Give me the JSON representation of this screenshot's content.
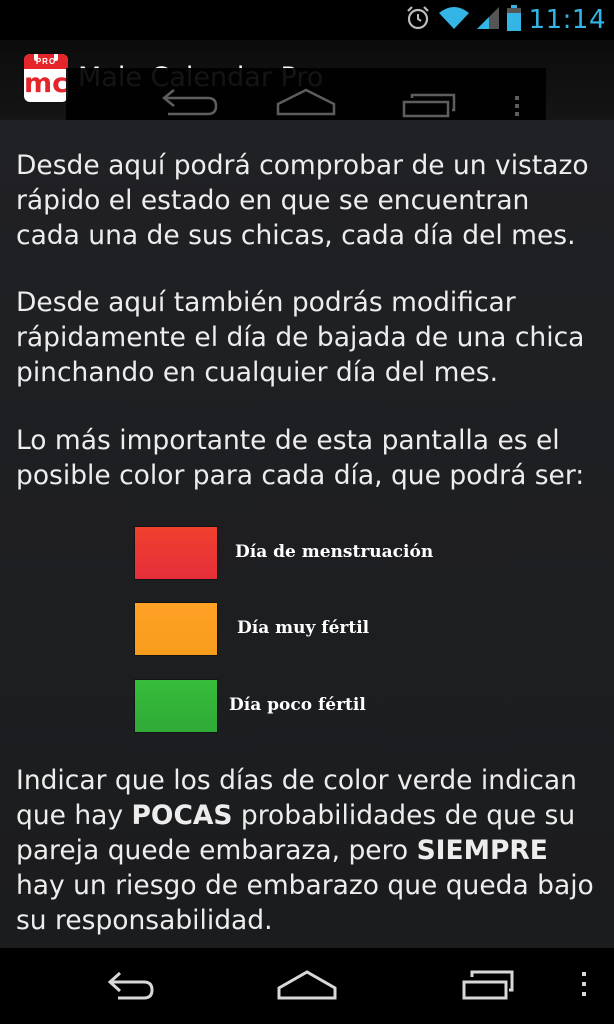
{
  "status_bar": {
    "time": "11:14",
    "icons": [
      "alarm-icon",
      "wifi-icon",
      "signal-icon",
      "battery-icon"
    ],
    "accent_color": "#33b5e5"
  },
  "action_bar": {
    "logo_badge": "PRO",
    "logo_text": "mc",
    "title": "Male Calendar Pro"
  },
  "content": {
    "paragraph1": "Desde aquí podrá comprobar de un vistazo rápido el estado en que se encuentran cada una de sus chicas, cada día del mes.",
    "paragraph2": "Desde aquí también podrás modificar rápidamente el día de bajada de una chica pinchando en cualquier día del mes.",
    "paragraph3": "Lo más importante de esta pantalla es el posible color para cada día, que podrá ser:",
    "legend": [
      {
        "label": "Día de menstruación",
        "color": "#e8302f"
      },
      {
        "label": "Día muy fértil",
        "color": "#fca020"
      },
      {
        "label": "Día poco fértil",
        "color": "#35b43a"
      }
    ],
    "paragraph4": {
      "part1": "Indicar que los días de color verde indican que hay ",
      "bold1": "POCAS",
      "part2": " probabilidades de que su pareja quede embaraza, pero ",
      "bold2": "SIEMPRE",
      "part3": " hay un riesgo de embarazo que queda bajo su responsabilidad."
    }
  },
  "nav_bar": {
    "buttons": [
      "back-icon",
      "home-icon",
      "recents-icon",
      "overflow-menu-icon"
    ]
  }
}
